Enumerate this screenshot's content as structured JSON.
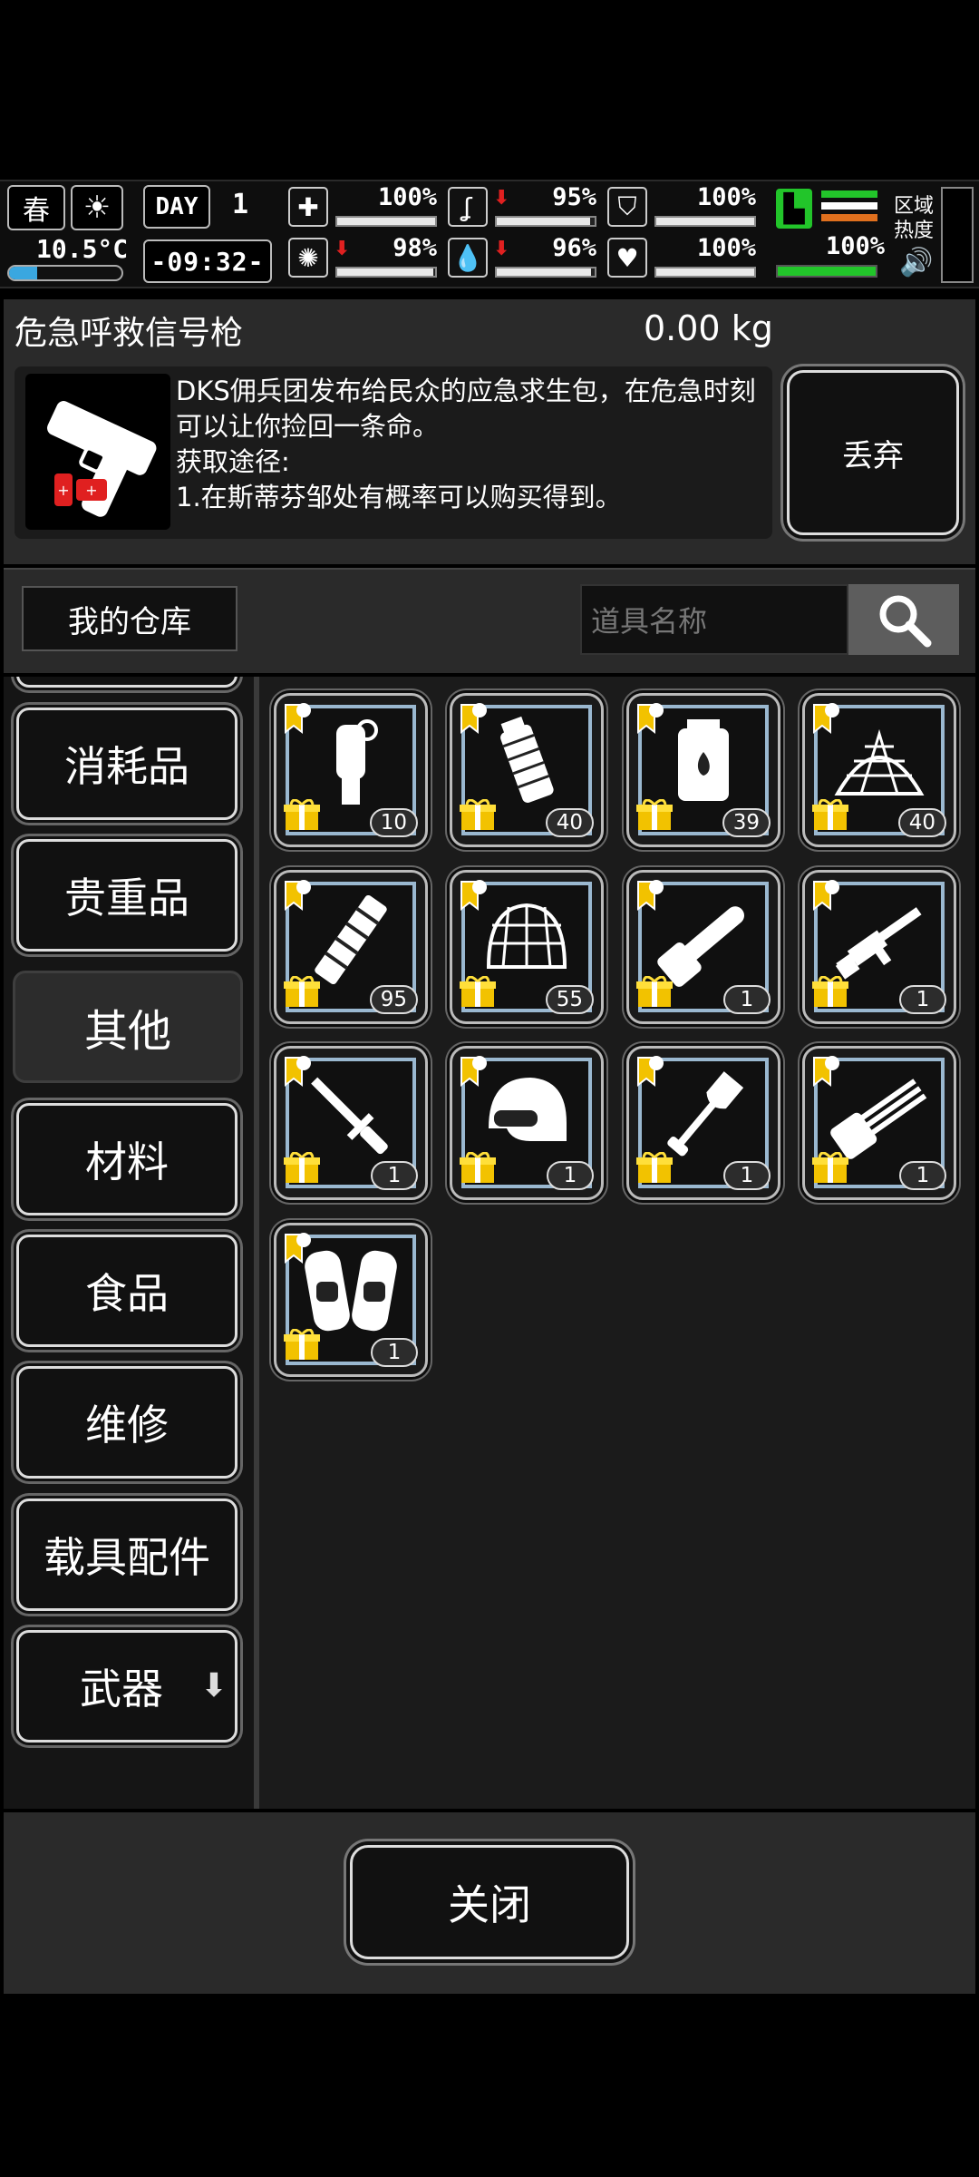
{
  "hud": {
    "season": "春",
    "temperature": "10.5°C",
    "temperature_level": 0.25,
    "day_label": "DAY",
    "day_number": "1",
    "clock": "-09:32-",
    "stats": [
      {
        "icon": "medkit-icon",
        "value": "100%",
        "fill": 1.0,
        "decreasing": false
      },
      {
        "icon": "stomach-icon",
        "value": "95%",
        "fill": 0.95,
        "decreasing": true
      },
      {
        "icon": "armor-icon",
        "value": "100%",
        "fill": 1.0,
        "decreasing": false
      },
      {
        "icon": "brain-icon",
        "value": "98%",
        "fill": 0.98,
        "decreasing": true
      },
      {
        "icon": "water-drop-icon",
        "value": "96%",
        "fill": 0.96,
        "decreasing": true
      },
      {
        "icon": "heart-icon",
        "value": "100%",
        "fill": 1.0,
        "decreasing": false
      }
    ],
    "stamina_value": "100%",
    "stamina_fill": 1.0,
    "zone_heat_label": "区域热度",
    "colors": {
      "stamina": "#22c52a",
      "heat_orange": "#e0701e",
      "heat_white": "#ffffff"
    }
  },
  "item_detail": {
    "name": "危急呼救信号枪",
    "weight": "0.00 kg",
    "description": "DKS佣兵团发布给民众的应急求生包，在危急时刻可以让你捡回一条命。",
    "acquire_title": "获取途径:",
    "acquire_text": "1.在斯蒂芬邹处有概率可以购买得到。",
    "discard_label": "丢弃"
  },
  "storage": {
    "title": "我的仓库",
    "search_placeholder": "道具名称"
  },
  "categories": [
    {
      "label": "消耗品",
      "active": false
    },
    {
      "label": "贵重品",
      "active": false
    },
    {
      "label": "其他",
      "active": true
    },
    {
      "label": "材料",
      "active": false
    },
    {
      "label": "食品",
      "active": false
    },
    {
      "label": "维修",
      "active": false
    },
    {
      "label": "载具配件",
      "active": false
    },
    {
      "label": "武器",
      "active": false
    }
  ],
  "items": [
    {
      "icon": "grenade-icon",
      "qty": "10"
    },
    {
      "icon": "frag-grenade-icon",
      "qty": "40"
    },
    {
      "icon": "incendiary-grenade-icon",
      "qty": "39"
    },
    {
      "icon": "camo-net-icon",
      "qty": "40"
    },
    {
      "icon": "magazine-icon",
      "qty": "95"
    },
    {
      "icon": "helmet-net-icon",
      "qty": "55"
    },
    {
      "icon": "chainsaw-icon",
      "qty": "1"
    },
    {
      "icon": "rifle-icon",
      "qty": "1"
    },
    {
      "icon": "bayonet-icon",
      "qty": "1"
    },
    {
      "icon": "tactical-helmet-icon",
      "qty": "1"
    },
    {
      "icon": "shovel-icon",
      "qty": "1"
    },
    {
      "icon": "minigun-icon",
      "qty": "1"
    },
    {
      "icon": "knee-pads-icon",
      "qty": "1"
    }
  ],
  "close_label": "关闭"
}
